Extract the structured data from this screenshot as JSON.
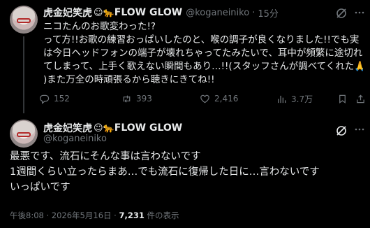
{
  "colors": {
    "background": "#000000",
    "text": "#e7e9ea",
    "muted": "#71767b",
    "divider": "#333639"
  },
  "tweet1": {
    "display_name": "虎金妃笑虎",
    "emoji_suffix": "☺🐆",
    "badge_text": "FLOW GLOW",
    "handle": "@koganeiniko",
    "separator": "·",
    "time": "15分",
    "lines": [
      "ニコたんのお歌変わった!?",
      "って方!!お歌の練習おっぱいしたのと、喉の調子が良くなりました!!でも実",
      "は今日ヘッドフォンの端子が壊れちゃってたみたいで、耳中が頻繁に途切れ",
      "てしまって、上手く歌えない瞬間もあり…!!(スタッフさんが調べてくれた🙏",
      ")また万全の時頑張るから聴きにきてね!!"
    ],
    "replies": "152",
    "reposts": "393",
    "likes": "2,416",
    "views": "3.7万"
  },
  "tweet2": {
    "display_name": "虎金妃笑虎",
    "emoji_suffix": "☺🐆",
    "badge_text": "FLOW GLOW",
    "handle": "@koganeiniko",
    "lines": [
      "最悪です、流石にそんな事は言わないです",
      "1週間くらい立ったらまあ…でも流石に復帰した日に…言わないです",
      "いっぱいです"
    ],
    "posted_at": "午後8:08 · 2026年5月16日 · ",
    "view_count": "7,231",
    "view_suffix": " 件の表示"
  },
  "icons": {
    "reply": "reply-icon",
    "repost": "repost-icon",
    "like": "heart-icon",
    "views": "views-icon",
    "bookmark": "bookmark-icon",
    "share": "share-icon",
    "grok": "grok-icon",
    "more": "more-icon"
  }
}
